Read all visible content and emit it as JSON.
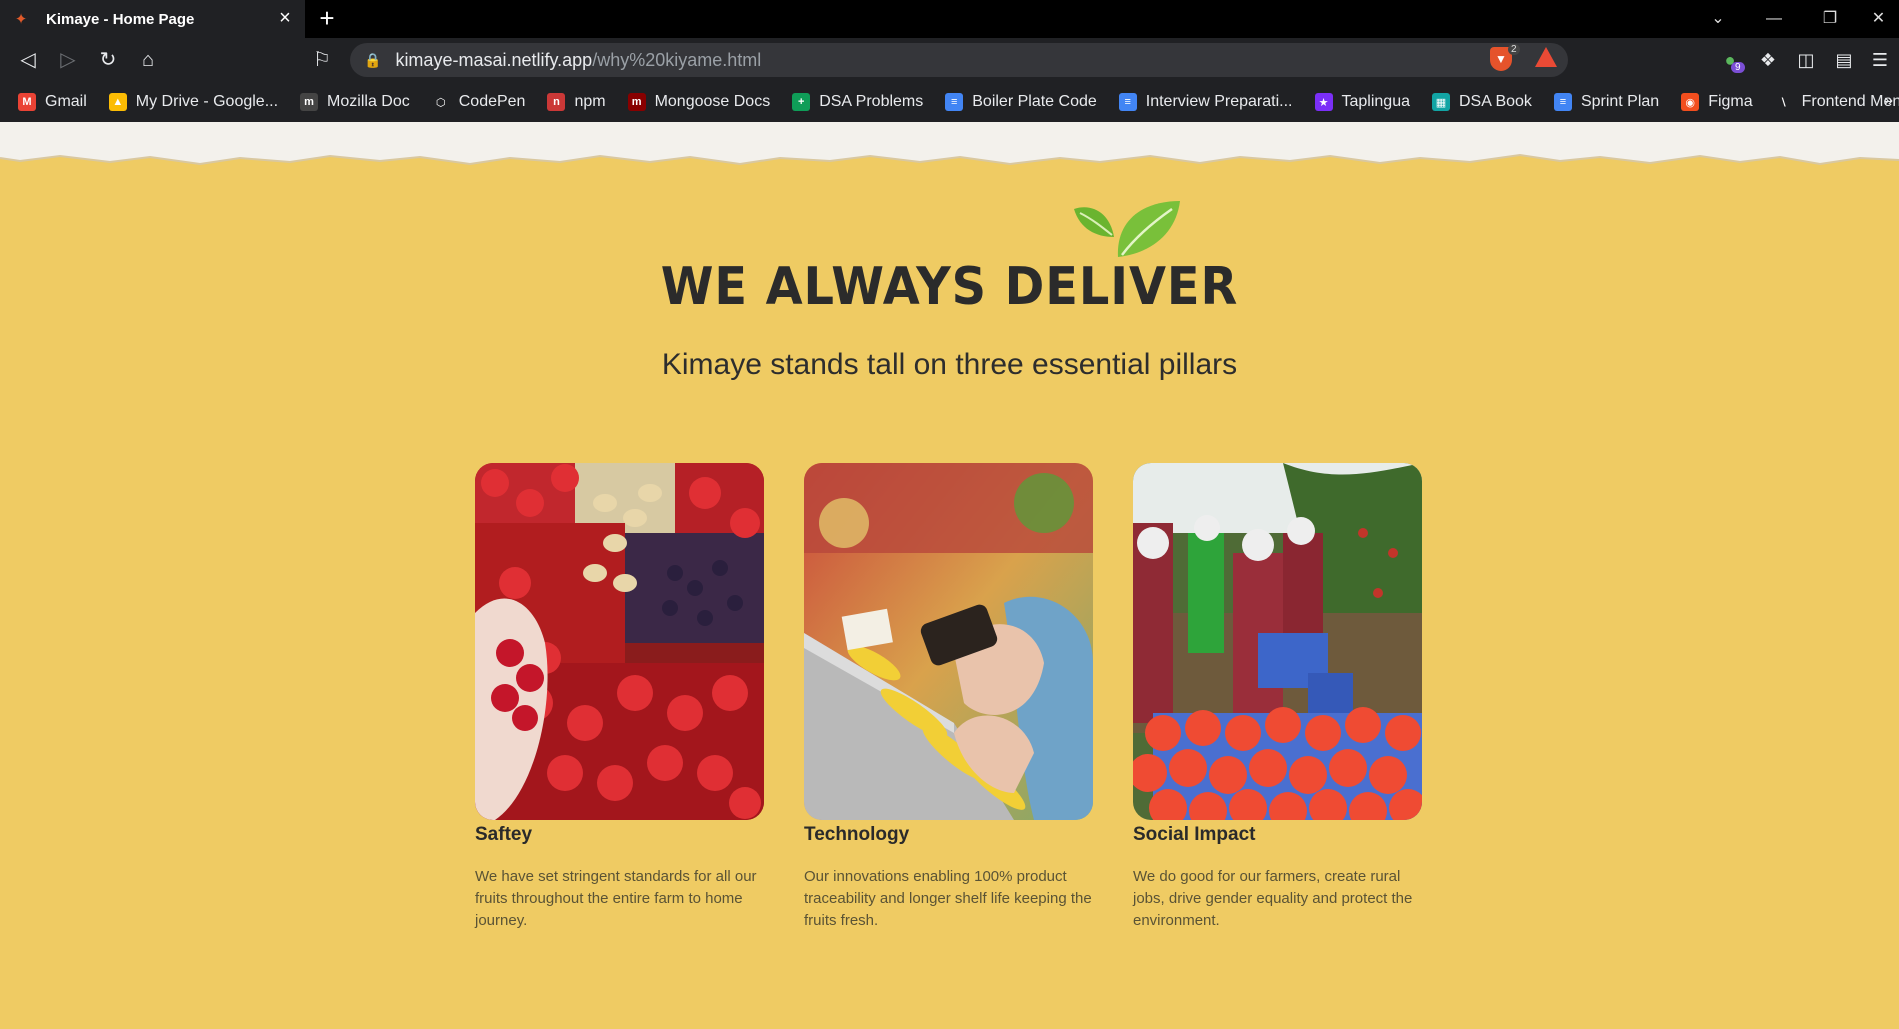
{
  "browser": {
    "tab_title": "Kimaye - Home Page",
    "url_host": "kimaye-masai.netlify.app",
    "url_path": "/why%20kiyame.html",
    "shield_count": "2",
    "extension_badge": "9"
  },
  "bookmarks": [
    {
      "label": "Gmail",
      "icon": "gmail-icon",
      "color": "#ea4335"
    },
    {
      "label": "My Drive - Google...",
      "icon": "drive-icon",
      "color": "#fbbc04"
    },
    {
      "label": "Mozilla Doc",
      "icon": "mdn-icon",
      "color": "#444444"
    },
    {
      "label": "CodePen",
      "icon": "codepen-icon",
      "color": "#ffffff"
    },
    {
      "label": "npm",
      "icon": "npm-icon",
      "color": "#cb3837"
    },
    {
      "label": "Mongoose Docs",
      "icon": "mongoose-icon",
      "color": "#880000"
    },
    {
      "label": "DSA Problems",
      "icon": "sheets-icon",
      "color": "#0f9d58"
    },
    {
      "label": "Boiler Plate Code",
      "icon": "docs-icon",
      "color": "#4285f4"
    },
    {
      "label": "Interview Preparati...",
      "icon": "docs-icon",
      "color": "#4285f4"
    },
    {
      "label": "Taplingua",
      "icon": "star-icon",
      "color": "#7b2ff7"
    },
    {
      "label": "DSA Book",
      "icon": "book-icon",
      "color": "#12a4a4"
    },
    {
      "label": "Sprint Plan",
      "icon": "sprint-icon",
      "color": "#4285f4"
    },
    {
      "label": "Figma",
      "icon": "figma-icon",
      "color": "#f24e1e"
    },
    {
      "label": "Frontend Mentor",
      "icon": "frontend-mentor-icon",
      "color": "#ffffff"
    }
  ],
  "main": {
    "headline": "WE ALWAYS DELIVER",
    "subheadline": "Kimaye stands tall on three essential pillars",
    "pillars": [
      {
        "title": "Saftey",
        "description": "We have set stringent standards for all our fruits throughout the entire farm to home journey.",
        "image": "cherries-and-grapes-photo"
      },
      {
        "title": "Technology",
        "description": "Our innovations enabling 100% product traceability and longer shelf life keeping the fruits fresh.",
        "image": "phone-scan-at-market-photo"
      },
      {
        "title": "Social Impact",
        "description": "We do good for our farmers, create rural jobs, drive gender equality and protect the environment.",
        "image": "pomegranate-harvest-photo"
      }
    ]
  },
  "colors": {
    "page_background": "#efcb63",
    "leaf_green": "#6ab42f",
    "heading_text": "#2b2b2b"
  }
}
